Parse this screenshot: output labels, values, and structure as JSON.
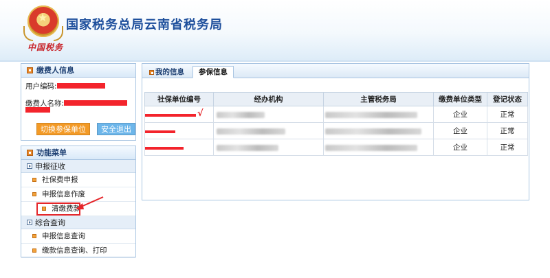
{
  "header": {
    "title": "国家税务总局云南省税务局",
    "brand_script": "中国税务"
  },
  "payer_panel": {
    "title": "缴费人信息",
    "user_code_label": "用户编码:",
    "user_name_label": "缴费人名称:",
    "switch_button": "切换参保单位",
    "logout_button": "安全退出"
  },
  "menu_panel": {
    "title": "功能菜单",
    "groups": [
      {
        "label": "申报征收",
        "items": [
          "社保费申报",
          "申报信息作废",
          "清缴费款"
        ]
      },
      {
        "label": "综合查询",
        "items": [
          "申报信息查询",
          "缴款信息查询、打印"
        ]
      }
    ]
  },
  "tabs": [
    "我的信息",
    "参保信息"
  ],
  "active_tab": "参保信息",
  "table": {
    "headers": [
      "社保单位编号",
      "经办机构",
      "主管税务局",
      "缴费单位类型",
      "登记状态"
    ],
    "rows": [
      {
        "unit_type": "企业",
        "status": "正常"
      },
      {
        "unit_type": "企业",
        "status": "正常"
      },
      {
        "unit_type": "企业",
        "status": "正常"
      }
    ]
  },
  "annotations": {
    "check_mark": "√"
  },
  "colors": {
    "title_blue": "#1e4f9c",
    "redaction_red": "#f3242c",
    "button_orange": "#f39a26",
    "button_blue": "#6db6ea",
    "highlight_red": "#e5262a"
  }
}
